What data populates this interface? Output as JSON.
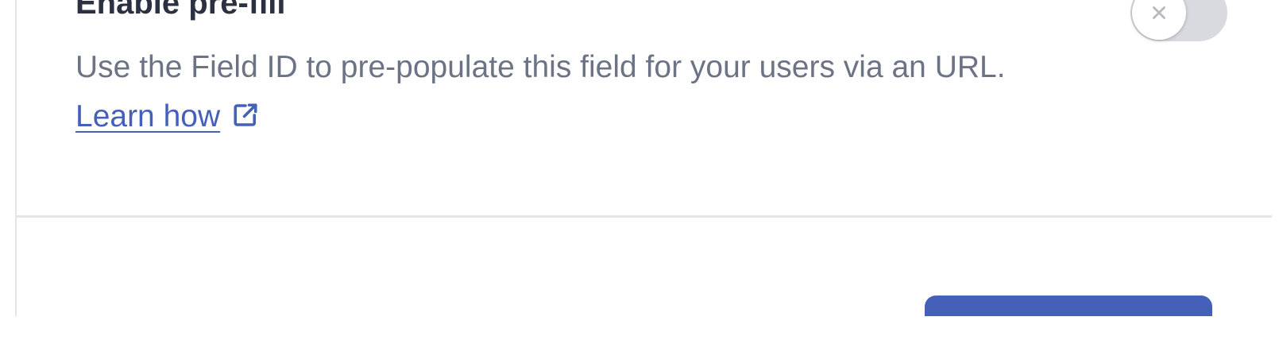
{
  "prefill_section": {
    "title": "Enable pre-fill",
    "description": "Use the Field ID to pre-populate this field for your users via an URL.",
    "learn_link_label": "Learn how",
    "learn_link_icon": "external-link-icon",
    "toggle": {
      "state": "off",
      "knob_icon": "x-icon"
    }
  },
  "footer": {
    "primary_button_label": ""
  },
  "colors": {
    "link": "#4560b8",
    "text_secondary": "#6b7385",
    "text_primary": "#2b3140",
    "button_primary": "#4560b8",
    "toggle_off": "#d8dadf",
    "divider": "#e3e5e8"
  }
}
